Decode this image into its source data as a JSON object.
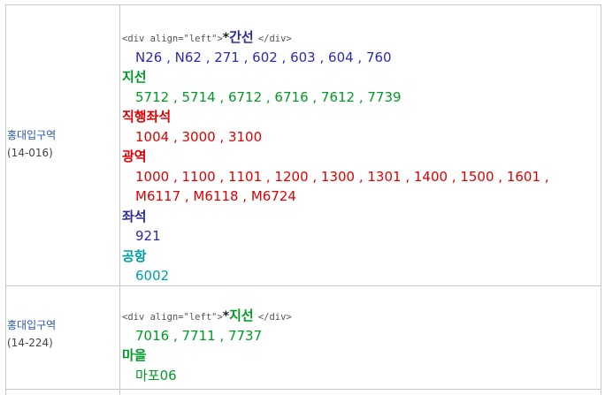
{
  "rows": [
    {
      "station_name": "홍대입구역",
      "station_code": "(14-016)",
      "tag_open": "<div align=\"left\">",
      "bullet": "*",
      "first_category": "간선",
      "tag_close": "</div>",
      "groups": [
        {
          "lines": [
            "N26 , N62 , 271 , 602 , 603 , 604 , 760"
          ]
        },
        {
          "category": "지선",
          "lines": [
            "5712 , 5714 , 6712 , 6716 , 7612 , 7739"
          ]
        },
        {
          "category": "직행좌석",
          "lines": [
            "1004 , 3000 , 3100"
          ]
        },
        {
          "category": "광역",
          "lines": [
            "1000 , 1100 , 1101 , 1200 , 1300 , 1301 , 1400 , 1500 , 1601 ,",
            "M6117 , M6118 , M6724"
          ]
        },
        {
          "category": "좌석",
          "lines": [
            "921"
          ]
        },
        {
          "category": "공항",
          "lines": [
            "6002"
          ]
        }
      ]
    },
    {
      "station_name": "홍대입구역",
      "station_code": "(14-224)",
      "tag_open": "<div align=\"left\">",
      "bullet": "*",
      "first_category": "지선",
      "tag_close": "</div>",
      "groups": [
        {
          "lines": [
            "7016 , 7711 , 7737"
          ]
        },
        {
          "category": "마을",
          "lines": [
            "마포06"
          ]
        }
      ]
    }
  ],
  "colors": {
    "trunk": "#2b2bb0",
    "branch": "#009a25",
    "express": "#e00000",
    "airport": "#00a0a5",
    "seat": "#2b2b9b"
  }
}
